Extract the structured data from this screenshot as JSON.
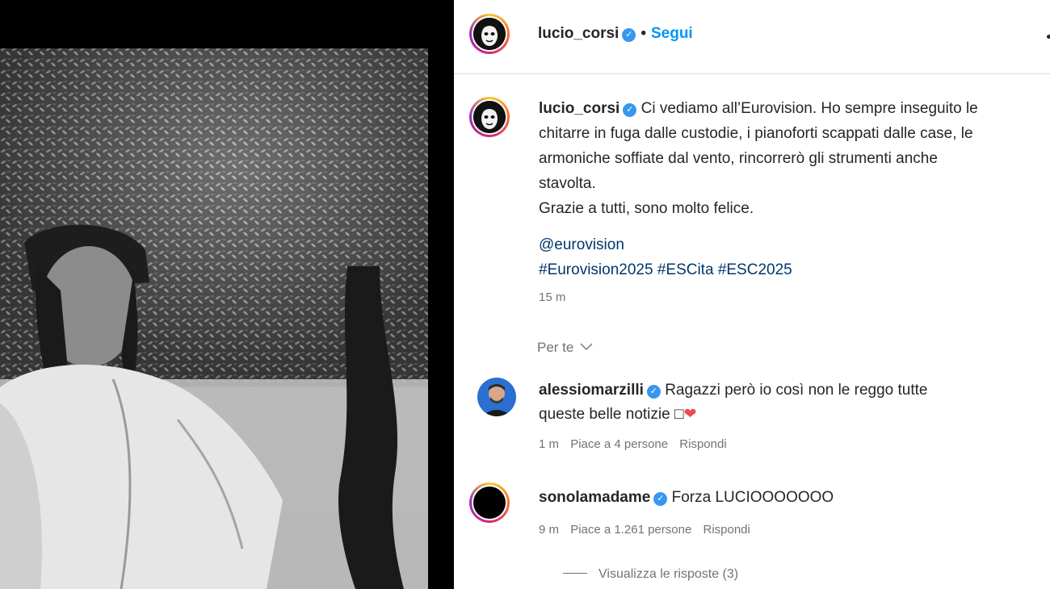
{
  "header": {
    "username": "lucio_corsi",
    "separator": "•",
    "follow_label": "Segui"
  },
  "caption": {
    "username": "lucio_corsi",
    "text_line1": "Ci vediamo all’Eurovision. Ho sempre inseguito le",
    "text_line2": "chitarre in fuga dalle custodie, i pianoforti scappati dalle case, le",
    "text_line3": "armoniche soffiate dal vento, rincorrerò gli strumenti anche",
    "text_line4": "stavolta.",
    "text_line5": "Grazie a tutti, sono molto felice.",
    "mention": "@eurovision",
    "hashtags": [
      "#Eurovision2025",
      "#ESCita",
      "#ESC2025"
    ],
    "time": "15 m"
  },
  "sort": {
    "label": "Per te",
    "icon": "chevron-down-icon"
  },
  "comments": [
    {
      "username": "alessiomarzilli",
      "text_line1": "Ragazzi però io così non le reggo tutte",
      "text_line2": "queste belle notizie",
      "emoji_box": "□",
      "emoji_heart": "❤",
      "time": "1 m",
      "likes": "Piace a 4 persone",
      "reply": "Rispondi"
    },
    {
      "username": "sonolamadame",
      "text": "Forza LUCIOOOOOOO",
      "time": "9 m",
      "likes": "Piace a 1.261 persone",
      "reply": "Rispondi",
      "view_replies": "Visualizza le risposte (3)"
    }
  ],
  "colors": {
    "link": "#00376b",
    "follow": "#0095f6",
    "verified": "#3897f0",
    "meta": "#737373"
  }
}
